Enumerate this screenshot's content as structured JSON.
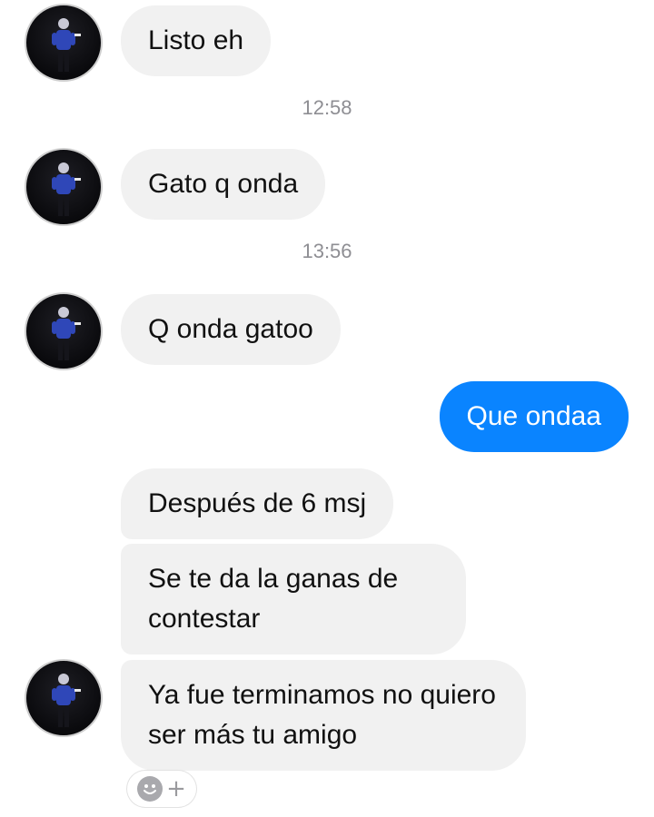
{
  "messages": {
    "m1": "Listo eh",
    "t1": "12:58",
    "m2": "Gato q onda",
    "t2": "13:56",
    "m3": "Q onda gatoo",
    "m4_outgoing": "Que ondaa",
    "m5": "Después de 6 msj",
    "m6": "Se te da la ganas de contestar",
    "m7": "Ya fue terminamos no quiero ser más tu amigo"
  },
  "colors": {
    "incoming_bubble": "#f1f1f1",
    "outgoing_bubble": "#0a84ff",
    "timestamp": "#8e8e93"
  },
  "icons": {
    "reaction": "smiley-face-icon",
    "add": "plus-icon"
  }
}
